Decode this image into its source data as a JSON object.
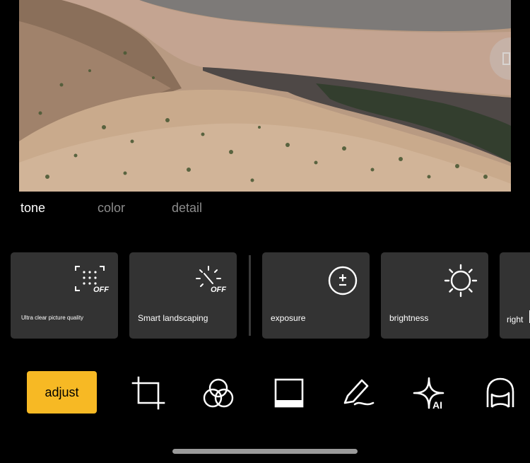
{
  "tabs": [
    {
      "label": "tone",
      "active": true
    },
    {
      "label": "color",
      "active": false
    },
    {
      "label": "detail",
      "active": false
    }
  ],
  "tools": [
    {
      "label": "Ultra clear picture quality",
      "badge": "OFF",
      "icon": "ultra-clear-icon"
    },
    {
      "label": "Smart landscaping",
      "badge": "OFF",
      "icon": "smart-landscape-icon"
    },
    {
      "label": "exposure",
      "icon": "exposure-icon"
    },
    {
      "label": "brightness",
      "icon": "brightness-icon"
    },
    {
      "label": "right",
      "icon": "partial-tool-icon"
    }
  ],
  "bottom_bar": {
    "active_label": "adjust",
    "icons": [
      "crop-icon",
      "filters-icon",
      "frame-icon",
      "draw-icon",
      "ai-retouch-icon",
      "portrait-icon"
    ]
  },
  "colors": {
    "accent": "#f7b924",
    "card": "#333333",
    "background": "#000000"
  }
}
